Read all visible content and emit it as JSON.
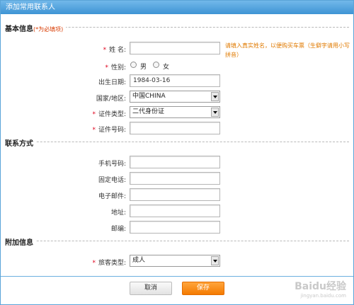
{
  "dialog": {
    "title": "添加常用联系人"
  },
  "sections": {
    "basic": {
      "title": "基本信息",
      "note": "(*为必填项)"
    },
    "contact": {
      "title": "联系方式"
    },
    "extra": {
      "title": "附加信息"
    }
  },
  "basic": {
    "name": {
      "label": "姓 名:",
      "value": "",
      "hint": "请填入真实姓名，以便购买车票（生僻字请用小写拼音）"
    },
    "gender": {
      "label": "性别:",
      "options": [
        "男",
        "女"
      ]
    },
    "birth": {
      "label": "出生日期:",
      "value": "1984-03-16"
    },
    "country": {
      "label": "国家/地区:",
      "value": "中国CHINA"
    },
    "id_type": {
      "label": "证件类型:",
      "value": "二代身份证"
    },
    "id_number": {
      "label": "证件号码:",
      "value": ""
    }
  },
  "contact": {
    "mobile": {
      "label": "手机号码:",
      "value": ""
    },
    "phone": {
      "label": "固定电话:",
      "value": ""
    },
    "email": {
      "label": "电子邮件:",
      "value": ""
    },
    "address": {
      "label": "地址:",
      "value": ""
    },
    "zip": {
      "label": "邮编:",
      "value": ""
    }
  },
  "extra": {
    "passenger_type": {
      "label": "旅客类型:",
      "value": "成人"
    }
  },
  "buttons": {
    "cancel": "取消",
    "save": "保存"
  },
  "required_mark": "*",
  "watermark": {
    "brand": "Baidu经验",
    "url": "jingyan.baidu.com"
  },
  "colors": {
    "title_bar": "#3e94d4",
    "required": "#e0001b",
    "hint": "#e07a00",
    "save_button": "#f47a00"
  }
}
